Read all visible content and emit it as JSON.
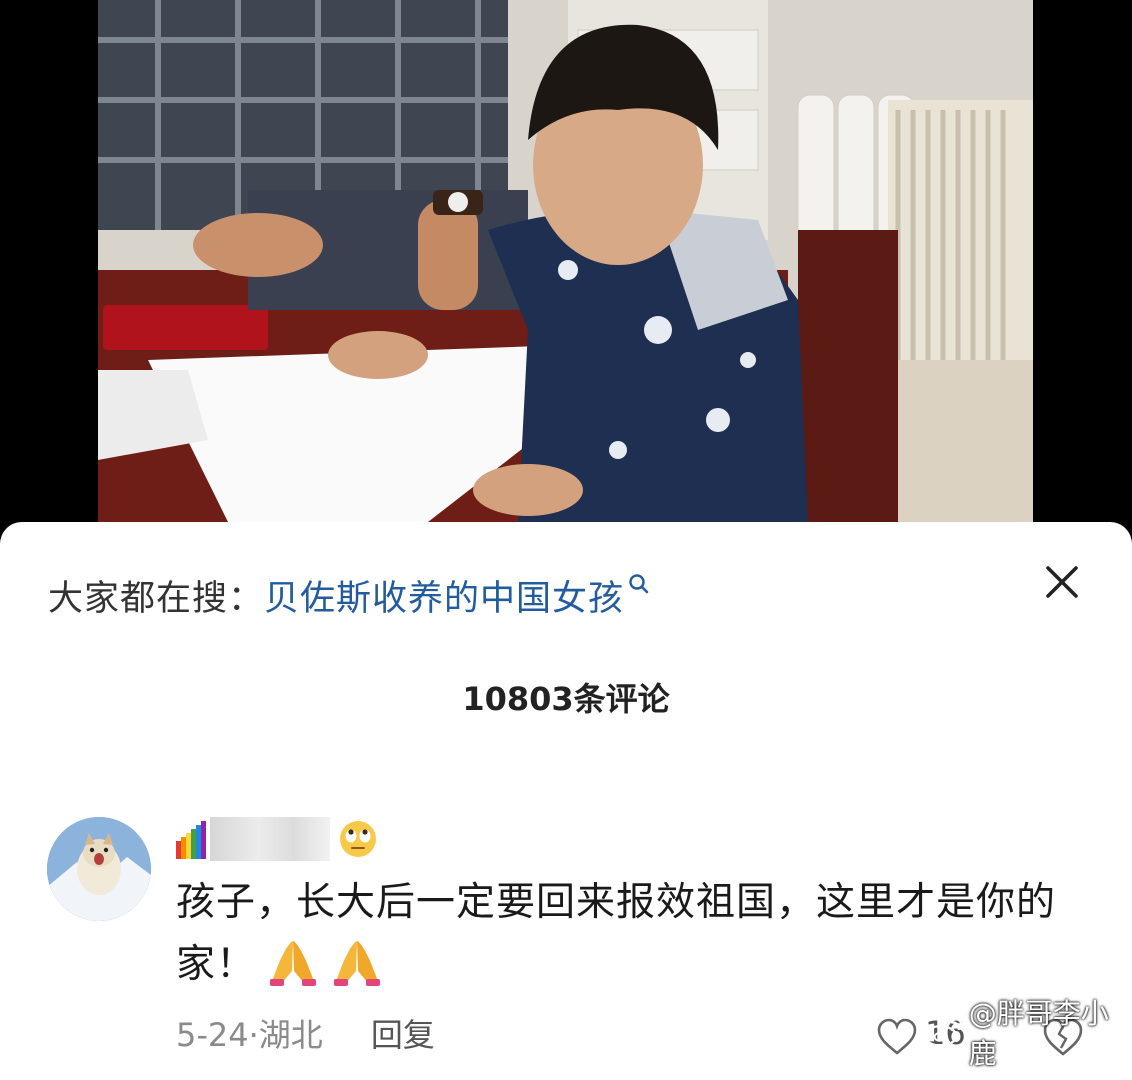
{
  "video": {},
  "search": {
    "prefix": "大家都在搜：",
    "term": "贝佐斯收养的中国女孩"
  },
  "comments_header": {
    "count_label": "10803条评论"
  },
  "comment": {
    "text": "孩子，长大后一定要回来报效祖国，这里才是你的家！",
    "date_location": "5-24·湖北",
    "reply_label": "回复",
    "like_count": "16"
  },
  "watermark": {
    "text": "@胖哥李小鹿"
  },
  "colors": {
    "search_link": "#235c9e",
    "sheet_bg": "#ffffff",
    "meta_gray": "#8a8a8a"
  },
  "icons": [
    "search-icon",
    "close-icon",
    "rainbow-icon",
    "rolling-eyes-emoji",
    "pray-emoji",
    "like-icon",
    "dislike-icon",
    "weibo-logo"
  ]
}
